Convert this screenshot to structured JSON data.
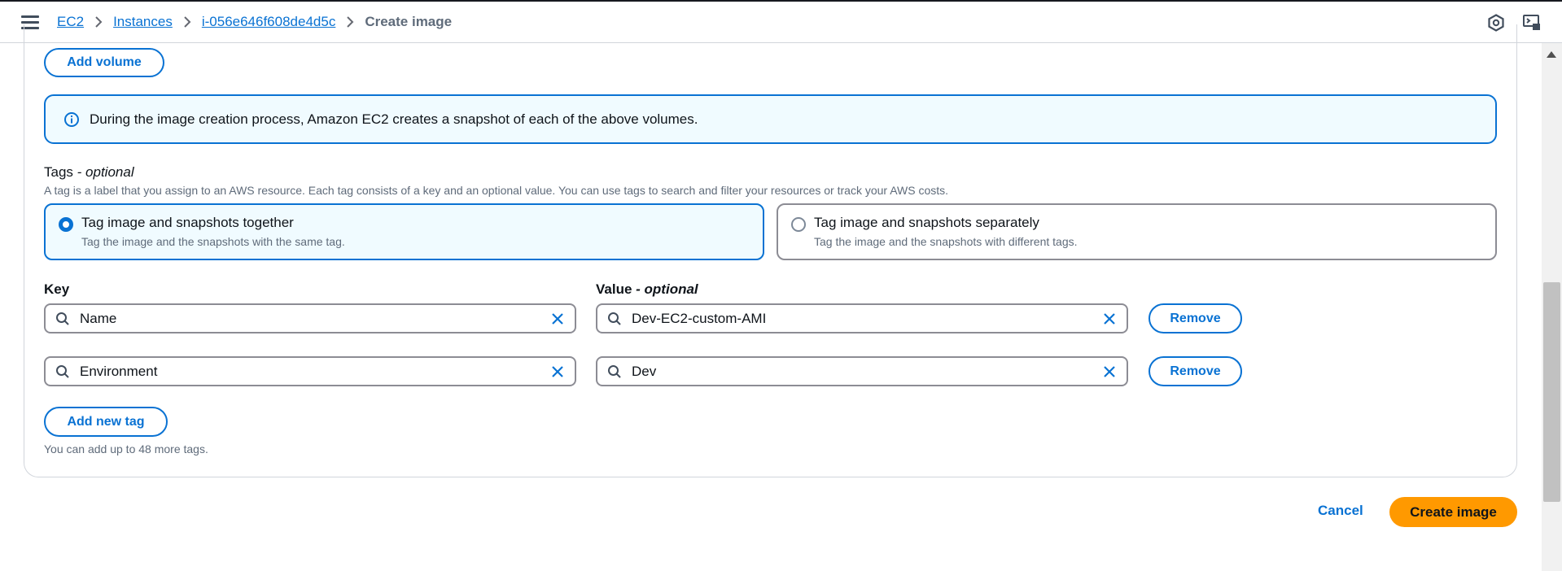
{
  "breadcrumb": {
    "items": [
      "EC2",
      "Instances",
      "i-056e646f608de4d5c"
    ],
    "current": "Create image"
  },
  "volumes": {
    "add_volume_label": "Add volume"
  },
  "info": {
    "message": "During the image creation process, Amazon EC2 creates a snapshot of each of the above volumes."
  },
  "tags": {
    "title": "Tags",
    "title_optional": "- optional",
    "description": "A tag is a label that you assign to an AWS resource. Each tag consists of a key and an optional value. You can use tags to search and filter your resources or track your AWS costs.",
    "options": [
      {
        "label": "Tag image and snapshots together",
        "sub": "Tag the image and the snapshots with the same tag.",
        "selected": true
      },
      {
        "label": "Tag image and snapshots separately",
        "sub": "Tag the image and the snapshots with different tags.",
        "selected": false
      }
    ],
    "key_label": "Key",
    "value_label": "Value",
    "value_optional": "- optional",
    "rows": [
      {
        "key": "Name",
        "value": "Dev-EC2-custom-AMI",
        "remove_label": "Remove"
      },
      {
        "key": "Environment",
        "value": "Dev",
        "remove_label": "Remove"
      }
    ],
    "add_tag_label": "Add new tag",
    "limit_hint": "You can add up to 48 more tags."
  },
  "footer": {
    "cancel_label": "Cancel",
    "create_label": "Create image"
  },
  "colors": {
    "accent": "#0972d3",
    "primary_button": "#ff9900",
    "info_bg": "#f0fbff"
  },
  "icons": [
    "menu-icon",
    "chevron-right-icon",
    "info-icon",
    "search-icon",
    "clear-icon",
    "notifications-icon",
    "cloudshell-icon"
  ]
}
